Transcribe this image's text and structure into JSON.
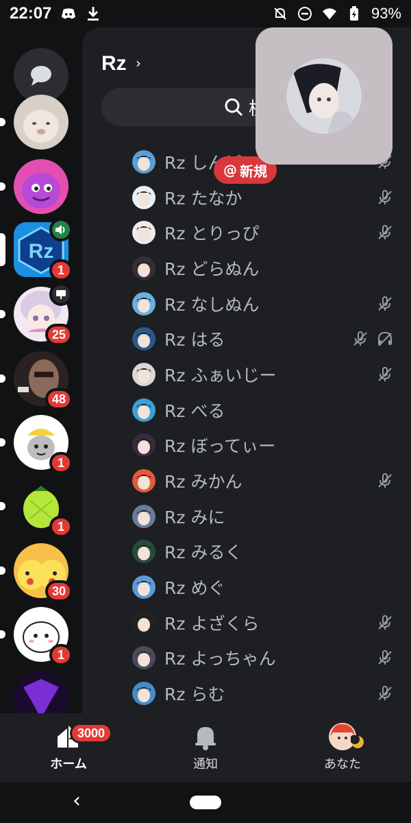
{
  "status_bar": {
    "time": "22:07",
    "battery": "93%",
    "icons": [
      "discord-icon",
      "download-icon",
      "notifications-off-icon",
      "do-not-disturb-icon",
      "wifi-icon",
      "battery-charging-icon"
    ]
  },
  "server_rail": {
    "servers": [
      {
        "name": "cat",
        "badge": "",
        "voice": false
      },
      {
        "name": "purple-creature",
        "badge": "",
        "voice": false
      },
      {
        "name": "Rz",
        "badge": "1",
        "voice": true,
        "selected": true
      },
      {
        "name": "anime-girl",
        "badge": "25",
        "stage": true
      },
      {
        "name": "blurry-face",
        "badge": "48"
      },
      {
        "name": "cat-helmet",
        "badge": "1"
      },
      {
        "name": "melon",
        "badge": "1"
      },
      {
        "name": "pikachu",
        "badge": "30"
      },
      {
        "name": "chiikawa",
        "badge": "1"
      },
      {
        "name": "purple-logo",
        "badge": ""
      }
    ]
  },
  "panel": {
    "server_name": "Rz",
    "search_label": "検",
    "new_pill_label": "新規",
    "members": [
      {
        "name": "Rz しんど",
        "muted": true,
        "deafened": false
      },
      {
        "name": "Rz たなか",
        "muted": true,
        "deafened": false
      },
      {
        "name": "Rz とりっぴ",
        "muted": true,
        "deafened": false
      },
      {
        "name": "Rz どらぬん",
        "muted": false,
        "deafened": false
      },
      {
        "name": "Rz なしぬん",
        "muted": true,
        "deafened": false
      },
      {
        "name": "Rz はる",
        "muted": true,
        "deafened": true
      },
      {
        "name": "Rz ふぁいじー",
        "muted": true,
        "deafened": false
      },
      {
        "name": "Rz べる",
        "muted": false,
        "deafened": false
      },
      {
        "name": "Rz ぼってぃー",
        "muted": false,
        "deafened": false
      },
      {
        "name": "Rz みかん",
        "muted": true,
        "deafened": false
      },
      {
        "name": "Rz みに",
        "muted": false,
        "deafened": false
      },
      {
        "name": "Rz みるく",
        "muted": false,
        "deafened": false
      },
      {
        "name": "Rz めぐ",
        "muted": false,
        "deafened": false
      },
      {
        "name": "Rz よざくら",
        "muted": true,
        "deafened": false
      },
      {
        "name": "Rz よっちゃん",
        "muted": true,
        "deafened": false
      },
      {
        "name": "Rz らむ",
        "muted": true,
        "deafened": false
      }
    ]
  },
  "bottom_nav": {
    "home": {
      "label": "ホーム",
      "badge": "3000"
    },
    "notifications": {
      "label": "通知"
    },
    "you": {
      "label": "あなた"
    }
  },
  "colors": {
    "background": "#111214",
    "panel": "#1e1f22",
    "badge_red": "#e53935",
    "voice_green": "#248046"
  }
}
